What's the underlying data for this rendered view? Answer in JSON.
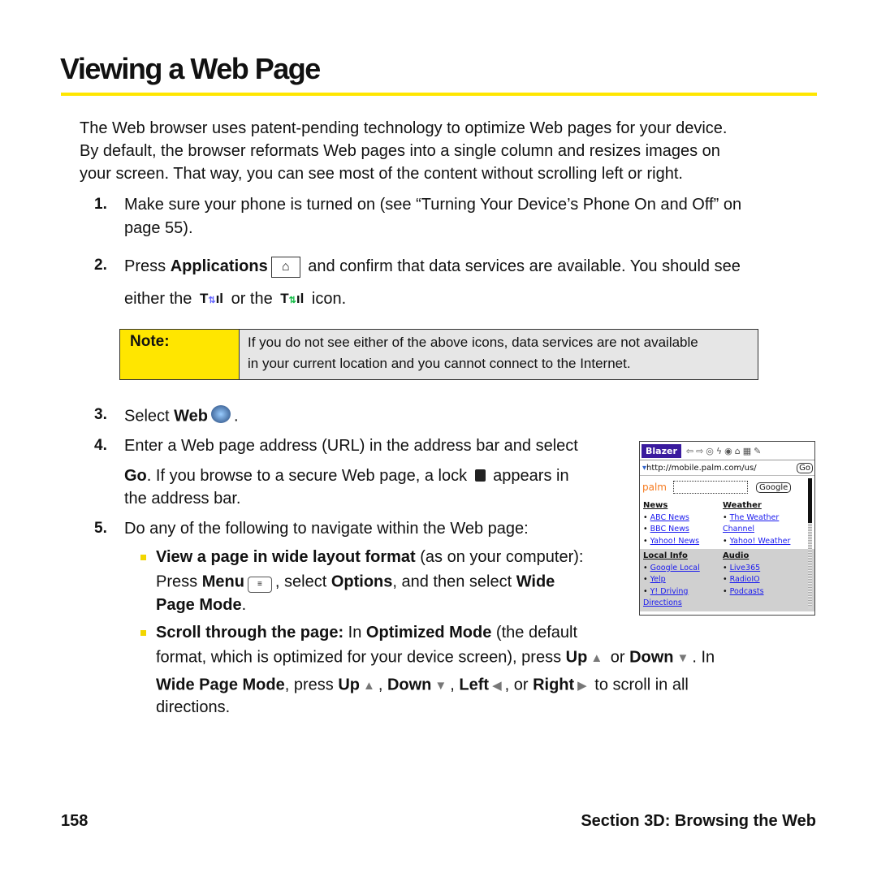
{
  "title": "Viewing a Web Page",
  "lines": [
    {
      "seg": [
        [
          "t",
          "The Web browser uses patent-pending technology to optimize Web pages for your device."
        ]
      ]
    },
    {
      "seg": [
        [
          "t",
          "By default, the browser reformats Web pages into a single column and resizes images on"
        ]
      ]
    },
    {
      "seg": [
        [
          "t",
          "your screen. That way, you can see most of the content without scrolling left or right."
        ]
      ]
    },
    {
      "num": "1.",
      "seg": [
        [
          "t",
          "Make sure your phone is turned on (see “Turning Your Device’s Phone On and Off” on"
        ]
      ]
    },
    {
      "seg": [
        [
          "t",
          "page 55)."
        ]
      ]
    },
    {
      "num": "2.",
      "seg": [
        [
          "t",
          "Press "
        ],
        [
          "b",
          "Applications"
        ],
        [
          "i",
          "home-key"
        ],
        [
          "t",
          " and confirm that data services are available. You should see"
        ]
      ]
    },
    {
      "seg": [
        [
          "t",
          "either the "
        ],
        [
          "i",
          "signal-data-blue"
        ],
        [
          "t",
          " or the "
        ],
        [
          "i",
          "signal-data-green"
        ],
        [
          "t",
          " icon."
        ]
      ]
    },
    {
      "num": "3.",
      "seg": [
        [
          "t",
          "Select "
        ],
        [
          "b",
          "Web"
        ],
        [
          "i",
          "web-globe"
        ],
        [
          "t",
          "."
        ]
      ]
    },
    {
      "num": "4.",
      "seg": [
        [
          "t",
          "Enter a Web page address (URL) in the address bar and select"
        ]
      ]
    },
    {
      "seg": [
        [
          "b",
          "Go"
        ],
        [
          "t",
          ". If you browse to a secure Web page, a lock "
        ],
        [
          "i",
          "lock"
        ],
        [
          "t",
          " appears in"
        ]
      ]
    },
    {
      "seg": [
        [
          "t",
          "the address bar."
        ]
      ]
    },
    {
      "num": "5.",
      "seg": [
        [
          "t",
          "Do any of the following to navigate within the Web page:"
        ]
      ]
    },
    {
      "bullet": true,
      "seg": [
        [
          "b",
          "View a page in wide layout format"
        ],
        [
          "t",
          " (as on your computer):"
        ]
      ]
    },
    {
      "seg": [
        [
          "t",
          "Press "
        ],
        [
          "b",
          "Menu"
        ],
        [
          "i",
          "menu-key"
        ],
        [
          "t",
          ", select "
        ],
        [
          "b",
          "Options"
        ],
        [
          "t",
          ", and then select "
        ],
        [
          "b",
          "Wide"
        ]
      ]
    },
    {
      "seg": [
        [
          "b",
          "Page Mode"
        ],
        [
          "t",
          "."
        ]
      ]
    },
    {
      "bullet": true,
      "seg": [
        [
          "b",
          "Scroll through the page:"
        ],
        [
          "t",
          " In "
        ],
        [
          "b",
          "Optimized Mode"
        ],
        [
          "t",
          " (the default"
        ]
      ]
    },
    {
      "seg": [
        [
          "t",
          "format, which is optimized for your device screen), press "
        ],
        [
          "b",
          "Up"
        ],
        [
          "i",
          "up"
        ],
        [
          "t",
          " or "
        ],
        [
          "b",
          "Down"
        ],
        [
          "i",
          "down"
        ],
        [
          "t",
          ". In"
        ]
      ]
    },
    {
      "seg": [
        [
          "b",
          "Wide Page Mode"
        ],
        [
          "t",
          ", press "
        ],
        [
          "b",
          "Up"
        ],
        [
          "i",
          "up"
        ],
        [
          "t",
          ", "
        ],
        [
          "b",
          "Down"
        ],
        [
          "i",
          "down"
        ],
        [
          "t",
          ", "
        ],
        [
          "b",
          "Left"
        ],
        [
          "i",
          "left"
        ],
        [
          "t",
          ", or "
        ],
        [
          "b",
          "Right"
        ],
        [
          "i",
          "right"
        ],
        [
          "t",
          " to scroll in all"
        ]
      ]
    },
    {
      "seg": [
        [
          "t",
          "directions."
        ]
      ]
    }
  ],
  "note": {
    "label": "Note:",
    "lines": [
      "If you do not see either of the above icons, data services are not available",
      "in your current location and you cannot connect to the Internet."
    ]
  },
  "screenshot": {
    "brand": "Blazer",
    "url": "http://mobile.palm.com/us/",
    "go": "Go",
    "logo": "palm",
    "search_button": "Google",
    "sections": [
      {
        "head": "News",
        "links": [
          "ABC News",
          "BBC News",
          "Yahoo! News"
        ]
      },
      {
        "head": "Weather",
        "links": [
          "The Weather Channel",
          "Yahoo! Weather"
        ]
      },
      {
        "head": "Local Info",
        "links": [
          "Google Local",
          "Yelp",
          "Y! Driving Directions"
        ]
      },
      {
        "head": "Audio",
        "links": [
          "Live365",
          "RadioIO",
          "Podcasts"
        ]
      }
    ]
  },
  "footer": {
    "page": "158",
    "section": "Section 3D: Browsing the Web"
  },
  "colors": {
    "accent": "#ffe600",
    "note_bg": "#e6e6e6",
    "brand": "#3a1b9e",
    "link": "#1a1aee"
  }
}
